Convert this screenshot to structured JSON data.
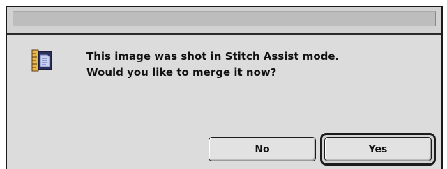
{
  "dialog": {
    "message_line_1": "This image was shot in Stitch Assist mode.",
    "message_line_2": "Would you like to merge it now?",
    "icon": "application-document-icon"
  },
  "buttons": {
    "no_label": "No",
    "yes_label": "Yes",
    "default_button": "Yes"
  },
  "colors": {
    "dialog_background": "#dcdcdc",
    "titlebar_background": "#d2d2d2",
    "border": "#1a1a1a",
    "text": "#111111"
  }
}
